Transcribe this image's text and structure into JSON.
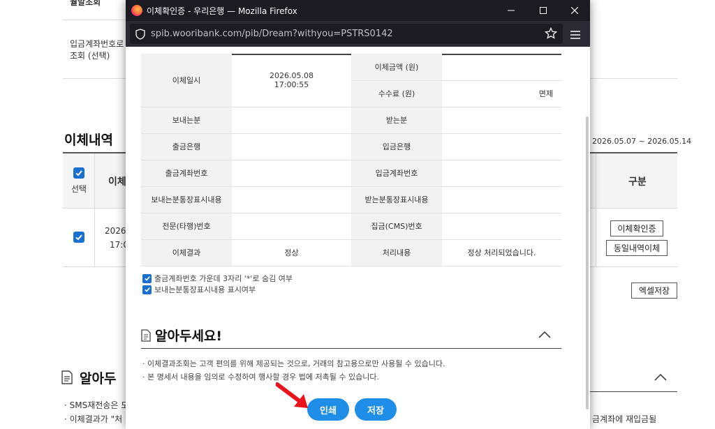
{
  "background": {
    "top_label": "월말조회",
    "account_label_line1": "입금계좌번호로",
    "account_label_line2": "조회 (선택)",
    "section_title": "이체내역",
    "date_range": "2026.05.07 ~ 2026.05.14",
    "col_select": "선택",
    "col_date": "이체",
    "col_type": "구분",
    "row_date_line1": "2026.",
    "row_date_line2": "17:0",
    "btn_confirm": "이체확인증",
    "btn_same": "동일내역이체",
    "btn_excel": "엑셀저장",
    "notice_title": "알아두",
    "notice_line1": "· SMS재전송은 도",
    "notice_line2": "· 이체결과가 \"처",
    "notice_right": "금계좌에 재입금될"
  },
  "window": {
    "title": "이체확인증 - 우리은행 — Mozilla Firefox",
    "url": "spib.wooribank.com/pib/Dream?withyou=PSTRS0142",
    "icons": {
      "logo": "firefox-logo-icon",
      "minimize": "minimize-icon",
      "maximize": "maximize-icon",
      "close": "close-icon",
      "security": "shield-icon",
      "bookmark": "star-icon",
      "menu": "hamburger-icon"
    }
  },
  "detail": {
    "transfer_datetime_label": "이체일시",
    "transfer_date": "2026.05.08",
    "transfer_time": "17:00:55",
    "amount_label": "이체금액 (원)",
    "amount_value": "",
    "fee_label": "수수료 (원)",
    "fee_value": "면제",
    "sender_label": "보내는분",
    "sender_value": "",
    "receiver_label": "받는분",
    "receiver_value": "",
    "out_bank_label": "출금은행",
    "out_bank_value": "",
    "in_bank_label": "입금은행",
    "in_bank_value": "",
    "out_account_label": "출금계좌번호",
    "out_account_value": "",
    "in_account_label": "입금계좌번호",
    "in_account_value": "",
    "sender_memo_label": "보내는분통장표시내용",
    "sender_memo_value": "",
    "receiver_memo_label": "받는분통장표시내용",
    "receiver_memo_value": "",
    "msg_no_label": "전문(타행)번호",
    "msg_no_value": "",
    "cms_label": "집금(CMS)번호",
    "cms_value": "",
    "result_label": "이체결과",
    "result_value": "정상",
    "process_label": "처리내용",
    "process_value": "정상 처리되었습니다."
  },
  "options": {
    "mask_account": "출금계좌번호 가운데 3자리 '*'로 숨김 여부",
    "show_memo": "보내는분통장표시내용 표시여부"
  },
  "notice": {
    "title": "알아두세요!",
    "item1": "· 이체결과조회는 고객 편의를 위해 제공되는 것으로, 거래의 참고용으로만 사용될 수 있습니다.",
    "item2": "· 본 명세서 내용을 임의로 수정하여 행사할 경우 법에 저촉될 수 있습니다."
  },
  "buttons": {
    "print": "인쇄",
    "save": "저장"
  },
  "colors": {
    "accent": "#1f8ee8",
    "checkbox": "#1a6fd1",
    "arrow": "#e8141c",
    "titlebar": "#1c1b22"
  }
}
